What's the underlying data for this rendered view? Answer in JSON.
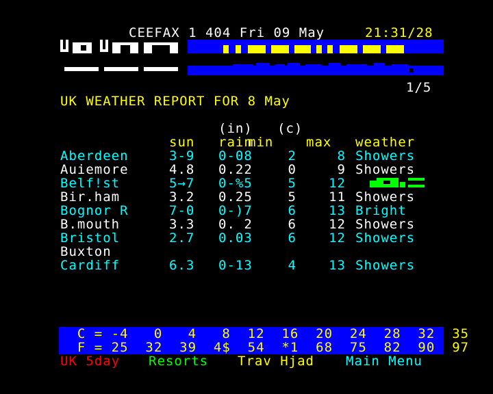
{
  "header": {
    "service": "CEEFAX 1 404 Fri 09 May",
    "time": "21:31/28"
  },
  "banner": {
    "graphic_word": "WEATHER",
    "accent": "#ffff00",
    "band": "#0000ff"
  },
  "page_counter": "1/5",
  "report_title": "UK WEATHER REPORT FOR 8 May",
  "units": {
    "rain": "(in)",
    "temp": "(c)"
  },
  "columns": {
    "sun": "sun",
    "rain": "rain",
    "min": "min",
    "max": "max",
    "weather": "weather"
  },
  "rows": [
    {
      "place": "Aberdeen",
      "sun": "3-9",
      "rain": "0-08",
      "min": "2",
      "max": "8",
      "weather": "Showers",
      "color": "cyan"
    },
    {
      "place": "Auiemore",
      "sun": "4.8",
      "rain": "0.22",
      "min": "0",
      "max": "9",
      "weather": "Showers",
      "color": "white"
    },
    {
      "place": "Belf!st",
      "sun": "5→7",
      "rain": "0-%5",
      "min": "5",
      "max": "12",
      "weather": "",
      "color": "cyan"
    },
    {
      "place": "Bir.ham",
      "sun": "3.2",
      "rain": "0.25",
      "min": "5",
      "max": "11",
      "weather": "Showers",
      "color": "white"
    },
    {
      "place": "Bognor R",
      "sun": "7-0",
      "rain": "0-)7",
      "min": "6",
      "max": "13",
      "weather": "Bright",
      "color": "cyan"
    },
    {
      "place": "B.mouth",
      "sun": "3.3",
      "rain": "0. 2",
      "min": "6",
      "max": "12",
      "weather": "Showers",
      "color": "white"
    },
    {
      "place": "Bristol",
      "sun": "2.7",
      "rain": "0.03",
      "min": "6",
      "max": "12",
      "weather": "Showers",
      "color": "cyan"
    },
    {
      "place": "Buxton",
      "sun": "",
      "rain": "",
      "min": "",
      "max": "",
      "weather": "",
      "color": "white"
    },
    {
      "place": "Cardiff",
      "sun": "6.3",
      "rain": "0-13",
      "min": "4",
      "max": "13",
      "weather": "Showers",
      "color": "cyan"
    }
  ],
  "conversion": {
    "c_line": "  C = -4   0   4   8  12  16  20  24  28  32  35",
    "f_line": "  F = 25  32  39  4$  54  *1  68  75  82  90  97"
  },
  "fastext": {
    "red": "UK 5day",
    "green": "Resorts",
    "yellow": "Trav Hjad",
    "cyan": "Main Menu"
  }
}
